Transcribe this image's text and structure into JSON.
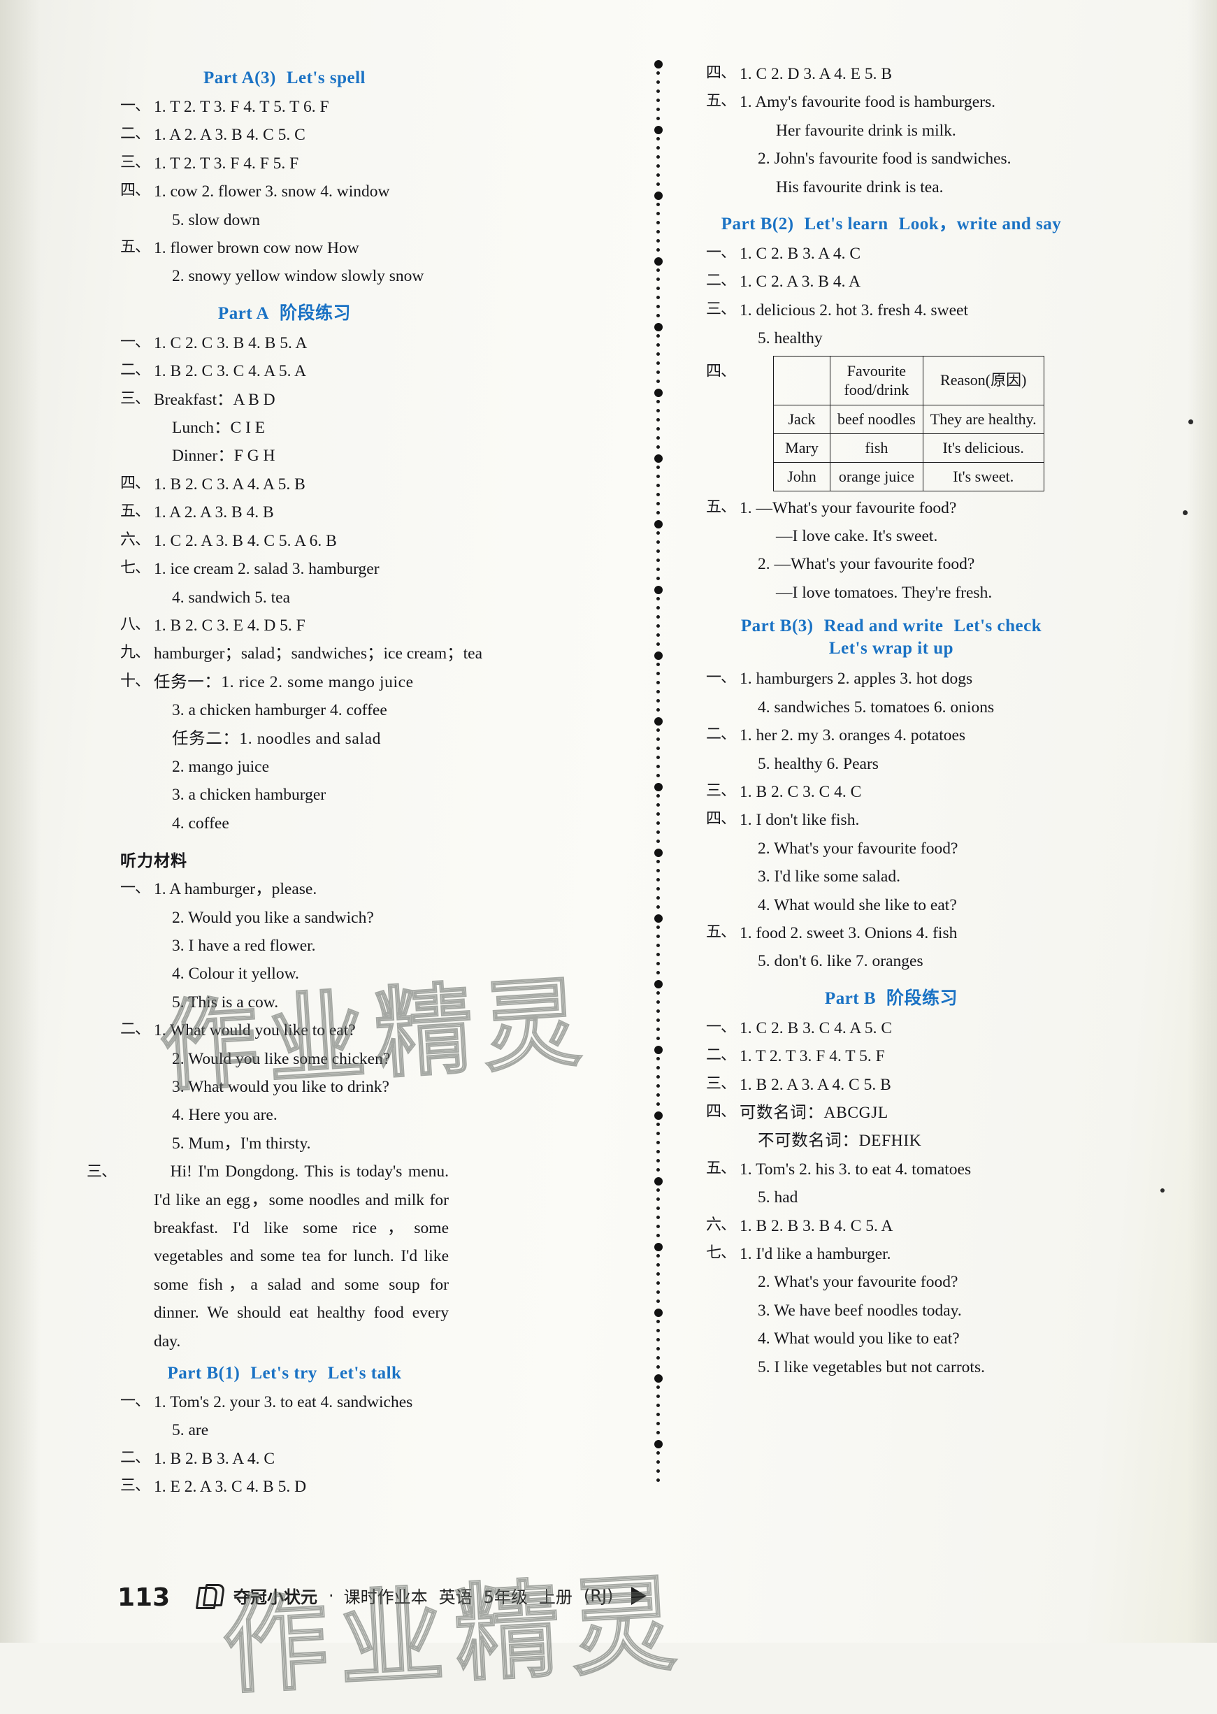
{
  "page": {
    "number": "113",
    "footer": {
      "brand": "夺冠小状元",
      "separator": "·",
      "book": "课时作业本",
      "subject": "英语",
      "grade": "5年级",
      "volume": "上册",
      "edition": "(RJ)"
    },
    "watermark": "作业精灵"
  },
  "colors": {
    "heading_blue": "#1a72c4",
    "text_black": "#16161a",
    "paper": "#f7f7f2"
  },
  "left_column": {
    "sections": [
      {
        "heading": [
          "Part  A(3)",
          "Let's spell"
        ],
        "items": [
          {
            "num": "一、",
            "text": "1. T   2. T   3. F   4. T   5. T   6. F"
          },
          {
            "num": "二、",
            "text": "1. A   2. A   3. B   4. C   5. C"
          },
          {
            "num": "三、",
            "text": "1. T   2. T   3. F   4. F   5. F"
          },
          {
            "num": "四、",
            "text": "1. cow   2. flower   3. snow   4. window"
          },
          {
            "num": "",
            "text": "5. slow down",
            "indent": 1
          },
          {
            "num": "五、",
            "text": "1. flower   brown   cow   now   How"
          },
          {
            "num": "",
            "text": "2. snowy   yellow   window   slowly   snow",
            "indent": 1
          }
        ]
      },
      {
        "heading": [
          "Part  A",
          "阶段练习"
        ],
        "items": [
          {
            "num": "一、",
            "text": "1. C   2. C   3. B   4. B   5. A"
          },
          {
            "num": "二、",
            "text": "1. B   2. C   3. C   4. A   5. A"
          },
          {
            "num": "三、",
            "text": "Breakfast：A   B   D"
          },
          {
            "num": "",
            "text": "Lunch：C   I   E",
            "indent": 1
          },
          {
            "num": "",
            "text": "Dinner：F   G   H",
            "indent": 1
          },
          {
            "num": "四、",
            "text": "1. B   2. C   3. A   4. A   5. B"
          },
          {
            "num": "五、",
            "text": "1. A   2. A   3. B   4. B"
          },
          {
            "num": "六、",
            "text": "1. C   2. A   3. B   4. C   5. A   6. B"
          },
          {
            "num": "七、",
            "text": "1. ice cream   2. salad   3. hamburger"
          },
          {
            "num": "",
            "text": "4. sandwich   5. tea",
            "indent": 1
          },
          {
            "num": "八、",
            "text": "1. B   2. C   3. E   4. D   5. F"
          },
          {
            "num": "九、",
            "text": "hamburger；salad；sandwiches；ice cream；tea"
          },
          {
            "num": "十、",
            "text": "任务一：1. rice   2. some mango juice",
            "cn_lead": true
          },
          {
            "num": "",
            "text": "3. a chicken hamburger   4. coffee",
            "indent": 1
          },
          {
            "num": "",
            "text": "任务二：1. noodles and salad",
            "indent": 1,
            "cn_lead": true
          },
          {
            "num": "",
            "text": "2. mango juice",
            "indent": 1
          },
          {
            "num": "",
            "text": "3. a chicken hamburger",
            "indent": 1
          },
          {
            "num": "",
            "text": "4. coffee",
            "indent": 1
          }
        ]
      },
      {
        "cn_heading": "听力材料",
        "items": [
          {
            "num": "一、",
            "text": "1. A hamburger，please."
          },
          {
            "num": "",
            "text": "2. Would you like a sandwich?",
            "indent": 1
          },
          {
            "num": "",
            "text": "3. I have a red flower.",
            "indent": 1
          },
          {
            "num": "",
            "text": "4. Colour it yellow.",
            "indent": 1
          },
          {
            "num": "",
            "text": "5. This is a cow.",
            "indent": 1
          },
          {
            "num": "二、",
            "text": "1. What would you like to eat?"
          },
          {
            "num": "",
            "text": "2. Would you like some chicken?",
            "indent": 1
          },
          {
            "num": "",
            "text": "3. What would you like to drink?",
            "indent": 1
          },
          {
            "num": "",
            "text": "4. Here you are.",
            "indent": 1
          },
          {
            "num": "",
            "text": "5. Mum，I'm thirsty.",
            "indent": 1
          }
        ],
        "paragraph": {
          "num": "三、",
          "text": "Hi! I'm Dongdong.  This is today's menu. I'd like an egg，some noodles and milk for breakfast. I'd like some rice，some vegetables and some tea for lunch. I'd like some fish，a salad and some soup for dinner. We should eat healthy food every day."
        }
      },
      {
        "heading": [
          "Part  B(1)",
          "Let's try",
          "Let's talk"
        ],
        "items": [
          {
            "num": "一、",
            "text": "1. Tom's   2. your   3. to eat   4. sandwiches"
          },
          {
            "num": "",
            "text": "5. are",
            "indent": 1
          },
          {
            "num": "二、",
            "text": "1. B   2. B   3. A   4. C"
          },
          {
            "num": "三、",
            "text": "1. E   2. A   3. C   4. B   5. D"
          }
        ]
      }
    ]
  },
  "right_column": {
    "sections": [
      {
        "items": [
          {
            "num": "四、",
            "text": "1. C   2. D   3. A   4. E   5. B"
          },
          {
            "num": "五、",
            "text": "1. Amy's favourite food is hamburgers."
          },
          {
            "num": "",
            "text": "Her favourite drink is milk.",
            "indent": 2
          },
          {
            "num": "",
            "text": "2. John's favourite food is sandwiches.",
            "indent": 1
          },
          {
            "num": "",
            "text": "His favourite drink is tea.",
            "indent": 2
          }
        ]
      },
      {
        "heading": [
          "Part  B(2)",
          "Let's learn",
          "Look，write and say"
        ],
        "items": [
          {
            "num": "一、",
            "text": "1. C   2. B   3. A   4. C"
          },
          {
            "num": "二、",
            "text": "1. C   2. A   3. B   4. A"
          },
          {
            "num": "三、",
            "text": "1. delicious   2. hot   3. fresh   4. sweet"
          },
          {
            "num": "",
            "text": "5. healthy",
            "indent": 1
          }
        ],
        "table": {
          "num": "四、",
          "headers": [
            "",
            "Favourite food/drink",
            "Reason(原因)"
          ],
          "rows": [
            [
              "Jack",
              "beef noodles",
              "They are healthy."
            ],
            [
              "Mary",
              "fish",
              "It's delicious."
            ],
            [
              "John",
              "orange juice",
              "It's sweet."
            ]
          ]
        },
        "items_after": [
          {
            "num": "五、",
            "text": "1. —What's your favourite food?"
          },
          {
            "num": "",
            "text": "—I love cake.  It's sweet.",
            "indent": 2
          },
          {
            "num": "",
            "text": "2. —What's your favourite food?",
            "indent": 1
          },
          {
            "num": "",
            "text": "—I love tomatoes.  They're fresh.",
            "indent": 2
          }
        ]
      },
      {
        "heading": [
          "Part  B(3)",
          "Read and write",
          "Let's check"
        ],
        "heading_line2": "Let's wrap it up",
        "items": [
          {
            "num": "一、",
            "text": "1. hamburgers   2. apples   3. hot dogs"
          },
          {
            "num": "",
            "text": "4. sandwiches   5. tomatoes   6. onions",
            "indent": 1
          },
          {
            "num": "二、",
            "text": "1. her   2. my   3. oranges   4. potatoes"
          },
          {
            "num": "",
            "text": "5. healthy   6. Pears",
            "indent": 1
          },
          {
            "num": "三、",
            "text": "1. B   2. C   3. C   4. C"
          },
          {
            "num": "四、",
            "text": "1. I don't like fish."
          },
          {
            "num": "",
            "text": "2. What's your favourite food?",
            "indent": 1
          },
          {
            "num": "",
            "text": "3. I'd like some salad.",
            "indent": 1
          },
          {
            "num": "",
            "text": "4. What would she like to eat?",
            "indent": 1
          },
          {
            "num": "五、",
            "text": "1. food   2. sweet   3. Onions   4. fish"
          },
          {
            "num": "",
            "text": "5. don't   6. like   7. oranges",
            "indent": 1
          }
        ]
      },
      {
        "heading": [
          "Part  B",
          "阶段练习"
        ],
        "items": [
          {
            "num": "一、",
            "text": "1. C   2. B   3. C   4. A   5. C"
          },
          {
            "num": "二、",
            "text": "1. T   2. T   3. F   4. T   5. F"
          },
          {
            "num": "三、",
            "text": "1. B   2. A   3. A   4. C   5. B"
          },
          {
            "num": "四、",
            "text": "可数名词：ABCGJL",
            "cn_lead": true
          },
          {
            "num": "",
            "text": "不可数名词：DEFHIK",
            "indent": 1,
            "cn_lead": true
          },
          {
            "num": "五、",
            "text": "1. Tom's   2. his   3. to eat   4. tomatoes"
          },
          {
            "num": "",
            "text": "5. had",
            "indent": 1
          },
          {
            "num": "六、",
            "text": "1. B   2. B   3. B   4. C   5. A"
          },
          {
            "num": "七、",
            "text": "1. I'd like a hamburger."
          },
          {
            "num": "",
            "text": "2. What's your favourite food?",
            "indent": 1
          },
          {
            "num": "",
            "text": "3. We have beef noodles today.",
            "indent": 1
          },
          {
            "num": "",
            "text": "4. What would you like to eat?",
            "indent": 1
          },
          {
            "num": "",
            "text": "5. I like vegetables but not carrots.",
            "indent": 1
          }
        ]
      }
    ]
  }
}
